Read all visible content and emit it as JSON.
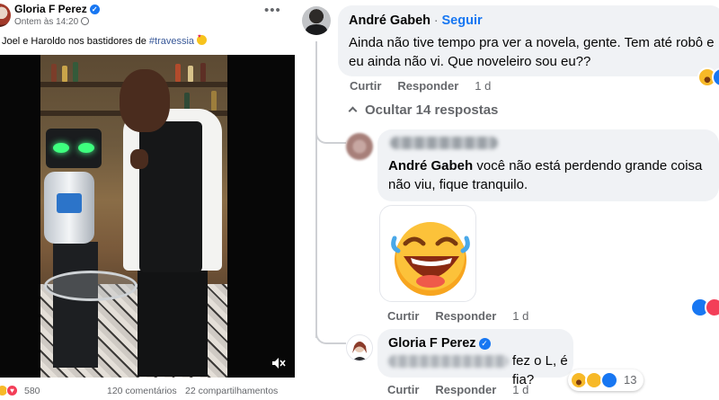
{
  "post": {
    "author": "Gloria F Perez",
    "timestamp": "Ontem às 14:20",
    "text_before_tag": "Joel e Haroldo nos bastidores de ",
    "hashtag": "#travessia",
    "reactions_count": "580",
    "comments_count": "120 comentários",
    "shares_count": "22 compartilhamentos",
    "icons": [
      "verified-badge",
      "globe-icon",
      "more-options-icon",
      "mute-icon",
      "haha-reaction",
      "love-reaction"
    ]
  },
  "comments": {
    "c1": {
      "author": "André Gabeh",
      "separator": " · ",
      "follow": "Seguir",
      "text": "Ainda não tive tempo pra ver a novela, gente. Tem até robô e eu ainda não vi. Que noveleiro sou eu??",
      "like": "Curtir",
      "reply": "Responder",
      "age": "1 d"
    },
    "hide_replies": "Ocultar 14 respostas",
    "c2": {
      "mention": "André Gabeh",
      "text": " você não está perdendo grande coisa não viu, fique tranquilo.",
      "like": "Curtir",
      "reply": "Responder",
      "age": "1 d"
    },
    "c3": {
      "author": "Gloria F Perez",
      "text": "fez o L, é fia?",
      "like": "Curtir",
      "reply": "Responder",
      "age": "1 d",
      "reactions_count": "13"
    }
  },
  "colors": {
    "facebook_blue": "#1877f2",
    "bubble_bg": "#f0f2f5",
    "secondary_text": "#65676b"
  }
}
